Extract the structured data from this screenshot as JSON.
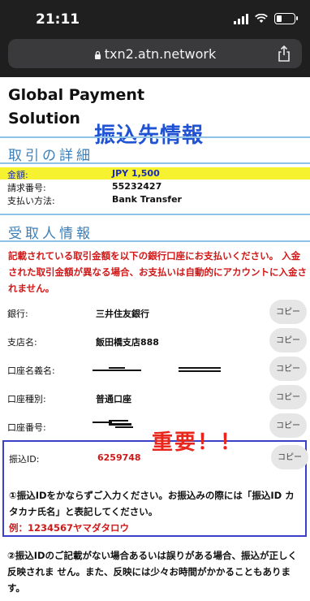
{
  "status_bar": {
    "time": "21:11"
  },
  "browser": {
    "url": "txn2.atn.network"
  },
  "brand": {
    "line1": "Global Payment",
    "line2": "Solution"
  },
  "overlay_title": "振込先情報",
  "transaction": {
    "section_title": "取引の詳細",
    "rows": [
      {
        "label": "金額:",
        "value": "JPY 1,500"
      },
      {
        "label": "請求番号:",
        "value": "55232427"
      },
      {
        "label": "支払い方法:",
        "value": "Bank Transfer"
      }
    ]
  },
  "recipient": {
    "section_title": "受取人情報",
    "notice": "記載されている取引金額を以下の銀行口座にお支払いください。 入金された取引金額が異なる場合、お支払いは自動的にアカウントに入金されません。",
    "copy_label": "コピー",
    "bank_label": "銀行:",
    "bank_value": "三井住友銀行",
    "branch_label": "支店名:",
    "branch_value": "飯田橋支店888",
    "holder_label": "口座名義名:",
    "type_label": "口座種別:",
    "type_value": "普通口座",
    "number_label": "口座番号:"
  },
  "important_label": "重要！！",
  "transfer": {
    "id_label": "振込ID:",
    "id_value": "6259748",
    "instruction": "①振込IDをかならずご入力ください。お振込みの際には「振込ID カタカナ氏名」と表記してください。",
    "example": "例：1234567ヤマダタロウ"
  },
  "footer_note": "②振込IDのご記載がない場合あるいは誤りがある場合、振込が正しく反映されま せん。また、反映には少々お時間がかかることもあります。"
}
